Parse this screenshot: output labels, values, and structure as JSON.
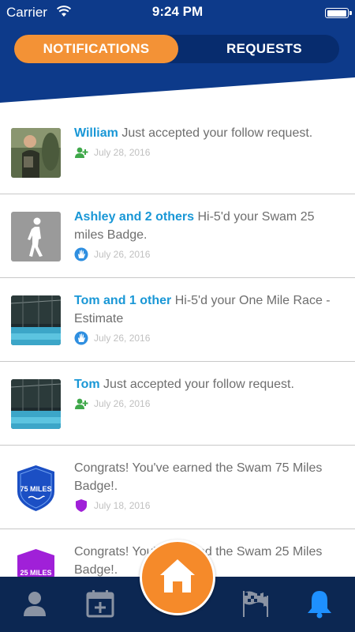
{
  "status_bar": {
    "carrier": "Carrier",
    "time": "9:24 PM"
  },
  "tabs": {
    "notifications": "NOTIFICATIONS",
    "requests": "REQUESTS",
    "active": "notifications"
  },
  "colors": {
    "header": "#0d3a8a",
    "accent_orange": "#f39236",
    "name_blue": "#1997d6",
    "nav_bg": "#0c2752",
    "bell_active": "#1e90ff"
  },
  "notifications": [
    {
      "name": "William",
      "text": " Just accepted your follow request.",
      "date": "July 28, 2016",
      "icon": "add-user-icon",
      "thumb": "user-photo"
    },
    {
      "name": "Ashley and 2 others",
      "text": " Hi-5'd your Swam 25 miles Badge.",
      "date": "July 26, 2016",
      "icon": "hand-icon",
      "thumb": "walking-person"
    },
    {
      "name": "Tom and 1 other",
      "text": " Hi-5'd your One Mile Race - Estimate",
      "date": "July 26, 2016",
      "icon": "hand-icon",
      "thumb": "pool-photo"
    },
    {
      "name": "Tom",
      "text": " Just accepted your follow request.",
      "date": "July 26, 2016",
      "icon": "add-user-icon",
      "thumb": "pool-photo"
    },
    {
      "name": "",
      "text": "Congrats! You've earned the Swam 75 Miles Badge!.",
      "date": "July 18, 2016",
      "icon": "badge-shield-icon",
      "thumb": "badge",
      "badge_label": "75 MILES",
      "badge_color": "#1b4fc4"
    },
    {
      "name": "",
      "text": "Congrats! You've earned the Swam 25 Miles Badge!.",
      "date": "",
      "icon": "",
      "thumb": "badge",
      "badge_label": "25 MILES",
      "badge_color": "#a020d8"
    }
  ],
  "bottom_nav": {
    "items": [
      "profile-icon",
      "calendar-add-icon",
      "home-icon",
      "flags-icon",
      "bell-icon"
    ],
    "active": "bell-icon"
  }
}
